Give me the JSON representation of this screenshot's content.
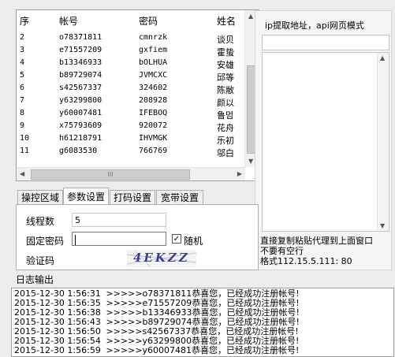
{
  "accounts": {
    "headers": {
      "index": "序",
      "account": "帐号",
      "password": "密码",
      "name": "姓名"
    },
    "rows": [
      {
        "index": "2",
        "account": "o78371811",
        "password": "cmnrzk",
        "name": "谈贝"
      },
      {
        "index": "3",
        "account": "e71557209",
        "password": "gxfiem",
        "name": "霍蛰"
      },
      {
        "index": "4",
        "account": "b13346933",
        "password": "bOLHUA",
        "name": "安雄"
      },
      {
        "index": "5",
        "account": "b89729074",
        "password": "JVMCXC",
        "name": "邱等"
      },
      {
        "index": "6",
        "account": "s42567337",
        "password": "324602",
        "name": "陈敝"
      },
      {
        "index": "7",
        "account": "y63299800",
        "password": "208928",
        "name": "颜以"
      },
      {
        "index": "8",
        "account": "y60007481",
        "password": "IFEBOQ",
        "name": "鲁멈"
      },
      {
        "index": "9",
        "account": "x75793609",
        "password": "920072",
        "name": "花舟"
      },
      {
        "index": "10",
        "account": "h61218791",
        "password": "IHVMGK",
        "name": "乐初"
      },
      {
        "index": "11",
        "account": "g6083530",
        "password": "766769",
        "name": "邬白"
      }
    ],
    "hscroll_grip": "III"
  },
  "ip_panel": {
    "title": "ip提取地址，api网页模式",
    "note_line1": "直接复制粘贴代理到上面窗口",
    "note_line2": "不要有空行",
    "note_line3": "格式112.15.5.111: 80"
  },
  "tabs": [
    {
      "label": "操控区域"
    },
    {
      "label": "参数设置"
    },
    {
      "label": "打码设置"
    },
    {
      "label": "宽带设置"
    }
  ],
  "params": {
    "threads_label": "线程数",
    "threads_value": "5",
    "fixed_pwd_label": "固定密码",
    "fixed_pwd_value": "",
    "random_label": "随机",
    "random_checked": "✓",
    "captcha_label": "验证码",
    "captcha_image_text": "4EKZZ"
  },
  "log": {
    "title": "日志输出",
    "lines": [
      {
        "time": "2015-12-30 1:56:31",
        "prefix": ">>>>>",
        "account": "o78371811",
        "msg": "恭喜您，已经成功注册帐号!"
      },
      {
        "time": "2015-12-30 1:56:35",
        "prefix": ">>>>>",
        "account": "e71557209",
        "msg": "恭喜您，已经成功注册帐号!"
      },
      {
        "time": "2015-12-30 1:56:38",
        "prefix": ">>>>>",
        "account": "b13346933",
        "msg": "恭喜您，已经成功注册帐号!"
      },
      {
        "time": "2015-12-30 1:56:43",
        "prefix": ">>>>>",
        "account": "b89729074",
        "msg": "恭喜您，已经成功注册帐号!"
      },
      {
        "time": "2015-12-30 1:56:50",
        "prefix": ">>>>>",
        "account": "s42567337",
        "msg": "恭喜您，已经成功注册帐号!"
      },
      {
        "time": "2015-12-30 1:56:54",
        "prefix": ">>>>>",
        "account": "y63299800",
        "msg": "恭喜您，已经成功注册帐号!"
      },
      {
        "time": "2015-12-30 1:56:59",
        "prefix": ">>>>>",
        "account": "y60007481",
        "msg": "恭喜您，已经成功注册帐号!"
      }
    ]
  }
}
